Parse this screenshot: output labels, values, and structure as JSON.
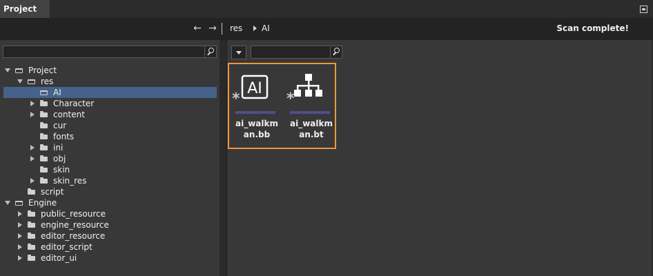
{
  "panel": {
    "tab_title": "Project",
    "pin_icon": "pin-icon"
  },
  "nav": {
    "back_icon": "←",
    "forward_icon": "→",
    "breadcrumbs": [
      "res",
      "AI"
    ],
    "status": "Scan complete!"
  },
  "tree_search": {
    "value": "",
    "placeholder": ""
  },
  "file_search": {
    "value": "",
    "placeholder": ""
  },
  "tree": [
    {
      "label": "Project",
      "depth": 0,
      "expander": "expanded",
      "folder": "open",
      "selected": false
    },
    {
      "label": "res",
      "depth": 1,
      "expander": "expanded",
      "folder": "open",
      "selected": false
    },
    {
      "label": "AI",
      "depth": 2,
      "expander": "none",
      "folder": "open",
      "selected": true
    },
    {
      "label": "Character",
      "depth": 2,
      "expander": "collapsed",
      "folder": "closed",
      "selected": false
    },
    {
      "label": "content",
      "depth": 2,
      "expander": "collapsed",
      "folder": "closed",
      "selected": false
    },
    {
      "label": "cur",
      "depth": 2,
      "expander": "none",
      "folder": "closed",
      "selected": false
    },
    {
      "label": "fonts",
      "depth": 2,
      "expander": "none",
      "folder": "closed",
      "selected": false
    },
    {
      "label": "ini",
      "depth": 2,
      "expander": "collapsed",
      "folder": "closed",
      "selected": false
    },
    {
      "label": "obj",
      "depth": 2,
      "expander": "collapsed",
      "folder": "closed",
      "selected": false
    },
    {
      "label": "skin",
      "depth": 2,
      "expander": "none",
      "folder": "closed",
      "selected": false
    },
    {
      "label": "skin_res",
      "depth": 2,
      "expander": "collapsed",
      "folder": "closed",
      "selected": false
    },
    {
      "label": "script",
      "depth": 1,
      "expander": "none",
      "folder": "closed",
      "selected": false
    },
    {
      "label": "Engine",
      "depth": 0,
      "expander": "expanded",
      "folder": "open",
      "selected": false
    },
    {
      "label": "public_resource",
      "depth": 1,
      "expander": "collapsed",
      "folder": "closed",
      "selected": false
    },
    {
      "label": "engine_resource",
      "depth": 1,
      "expander": "collapsed",
      "folder": "closed",
      "selected": false
    },
    {
      "label": "editor_resource",
      "depth": 1,
      "expander": "collapsed",
      "folder": "closed",
      "selected": false
    },
    {
      "label": "editor_script",
      "depth": 1,
      "expander": "collapsed",
      "folder": "closed",
      "selected": false
    },
    {
      "label": "editor_ui",
      "depth": 1,
      "expander": "collapsed",
      "folder": "closed",
      "selected": false
    }
  ],
  "files": [
    {
      "name_line1": "ai_walkm",
      "name_line2": "an.bb",
      "icon": "ai-blackboard-icon",
      "star": "*"
    },
    {
      "name_line1": "ai_walkm",
      "name_line2": "an.bt",
      "icon": "behavior-tree-icon",
      "star": "*"
    }
  ],
  "colors": {
    "selection_frame": "#f2963a",
    "tree_selected": "#45628a",
    "file_bar": "#4e4f91"
  }
}
